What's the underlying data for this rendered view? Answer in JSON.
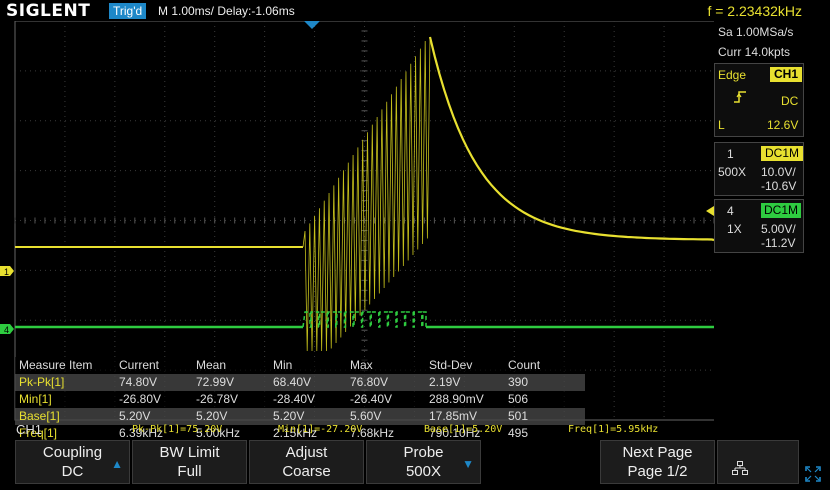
{
  "top": {
    "logo": "SIGLENT",
    "trig_status": "Trig'd",
    "timebase": "M 1.00ms/ Delay:-1.06ms",
    "frequency": "f = 2.23432kHz"
  },
  "acquisition": {
    "sample_rate": "Sa 1.00MSa/s",
    "memory": "Curr 14.0kpts"
  },
  "trigger": {
    "type": "Edge",
    "source": "CH1",
    "coupling": "DC",
    "level_label": "L",
    "level": "12.6V"
  },
  "channels": [
    {
      "num": "1",
      "coupling": "DC1M",
      "probe": "500X",
      "scale": "10.0V/",
      "offset": "-10.6V",
      "color": "#e8e030"
    },
    {
      "num": "4",
      "coupling": "DC1M",
      "probe": "1X",
      "scale": "5.00V/",
      "offset": "-11.2V",
      "color": "#2ecc40"
    }
  ],
  "measure": {
    "headers": [
      "Measure Item",
      "Current",
      "Mean",
      "Min",
      "Max",
      "Std-Dev",
      "Count"
    ],
    "rows": [
      [
        "Pk-Pk[1]",
        "74.80V",
        "72.99V",
        "68.40V",
        "76.80V",
        "2.19V",
        "390"
      ],
      [
        "Min[1]",
        "-26.80V",
        "-26.78V",
        "-28.40V",
        "-26.40V",
        "288.90mV",
        "506"
      ],
      [
        "Base[1]",
        "5.20V",
        "5.20V",
        "5.20V",
        "5.60V",
        "17.85mV",
        "501"
      ],
      [
        "Freq[1]",
        "6.39kHz",
        "5.00kHz",
        "2.15kHz",
        "7.68kHz",
        "790.10Hz",
        "495"
      ]
    ]
  },
  "status": {
    "channel": "CH1",
    "items": [
      "Pk-Pk[1]=75.20V",
      "Min[1]=-27.20V",
      "Base[1]=5.20V",
      "Freq[1]=5.95kHz"
    ]
  },
  "menu": {
    "coupling": {
      "title": "Coupling",
      "value": "DC"
    },
    "bwlimit": {
      "title": "BW Limit",
      "value": "Full"
    },
    "adjust": {
      "title": "Adjust",
      "value": "Coarse"
    },
    "probe": {
      "title": "Probe",
      "value": "500X"
    },
    "nextpage": {
      "title": "Next Page",
      "value": "Page 1/2"
    }
  },
  "icons": {
    "menu_arrow": "triangle-down-icon",
    "network": "network-icon",
    "fullscreen": "expand-icon"
  },
  "colors": {
    "ch1": "#e8e030",
    "ch4": "#2ecc40",
    "accent": "#1e88c8"
  }
}
